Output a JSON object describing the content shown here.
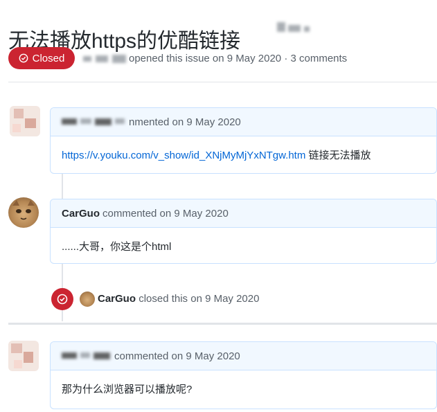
{
  "issue": {
    "title": "无法播放https的优酷链接",
    "state_label": "Closed",
    "meta_text": "opened this issue on 9 May 2020 · 3 comments"
  },
  "comments": [
    {
      "author": "",
      "action": "nmented on 9 May 2020",
      "link": "https://v.youku.com/v_show/id_XNjMyMjYxNTgw.htm",
      "body": "链接无法播放"
    },
    {
      "author": "CarGuo",
      "action": "commented on 9 May 2020",
      "body": "......大哥，你这是个html"
    },
    {
      "author": "",
      "action": "commented on 9 May 2020",
      "body": "那为什么浏览器可以播放呢?"
    }
  ],
  "event": {
    "author": "CarGuo",
    "text": "closed this on 9 May 2020"
  },
  "colors": {
    "closed_red": "#cb2431",
    "link_blue": "#0366d6",
    "header_blue": "#f1f8ff",
    "border_blue": "#c8e1ff"
  },
  "icons": {
    "state": "issue-closed-icon",
    "event": "issue-closed-icon"
  }
}
